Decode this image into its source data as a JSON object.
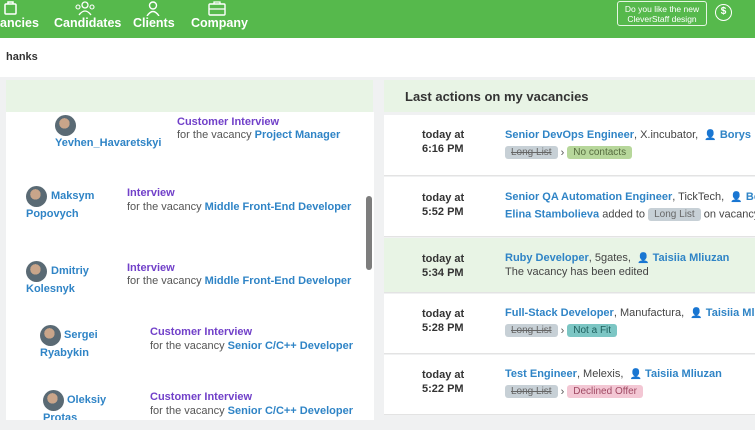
{
  "nav": {
    "vacancies": "ancies",
    "candidates": "Candidates",
    "clients": "Clients",
    "company": "Company",
    "promo_line1": "Do you like the new",
    "promo_line2": "CleverStaff design",
    "dollar": "$"
  },
  "subheader": {
    "title": "hanks"
  },
  "left": {
    "items": [
      {
        "name1": "Yevhen_Havaretskyi",
        "name2": "",
        "type": "Customer Interview",
        "for_text": "for the vacancy",
        "vacancy": "Project Manager"
      },
      {
        "name1": "Maksym",
        "name2": "Popovych",
        "type": "Interview",
        "for_text": "for the vacancy",
        "vacancy": "Middle Front-End Developer"
      },
      {
        "name1": "Dmitriy",
        "name2": "Kolesnyk",
        "type": "Interview",
        "for_text": "for the vacancy",
        "vacancy": "Middle Front-End Developer"
      },
      {
        "name1": "Sergei",
        "name2": "Ryabykin",
        "type": "Customer Interview",
        "for_text": "for the vacancy",
        "vacancy": "Senior C/C++ Developer"
      },
      {
        "name1": "Oleksiy",
        "name2": "Protas",
        "type": "Customer Interview",
        "for_text": "for the vacancy",
        "vacancy": "Senior C/C++ Developer"
      }
    ]
  },
  "right": {
    "title": "Last actions on my vacancies",
    "rows": [
      {
        "day": "today at",
        "time": "6:16 PM",
        "vacancy": "Senior DevOps Engineer",
        "client": ", X.incubator,",
        "user": "Borys",
        "from": "Long List",
        "to": "No contacts"
      },
      {
        "day": "today at",
        "time": "5:52 PM",
        "vacancy": "Senior QA Automation Engineer",
        "client": ", TickTech,",
        "user": "Bory",
        "cand": "Elina Stambolieva",
        "added": "added to",
        "list": "Long List",
        "on": "on vacancy"
      },
      {
        "day": "today at",
        "time": "5:34 PM",
        "vacancy": "Ruby Developer",
        "client": ", 5gates,",
        "user": "Taisiia Mliuzan",
        "note": "The vacancy has been edited"
      },
      {
        "day": "today at",
        "time": "5:28 PM",
        "vacancy": "Full-Stack Developer",
        "client": ", Manufactura,",
        "user": "Taisiia Mliuza",
        "from": "Long List",
        "to": "Not a Fit"
      },
      {
        "day": "today at",
        "time": "5:22 PM",
        "vacancy": "Test Engineer",
        "client": ", Melexis,",
        "user": "Taisiia Mliuzan",
        "from": "Long List",
        "to": "Declined Offer"
      }
    ]
  },
  "colors": {
    "brand_green": "#56b94c",
    "link_blue": "#2f84c6",
    "purple": "#7140c9",
    "panel_tint": "#e8f4e5"
  }
}
